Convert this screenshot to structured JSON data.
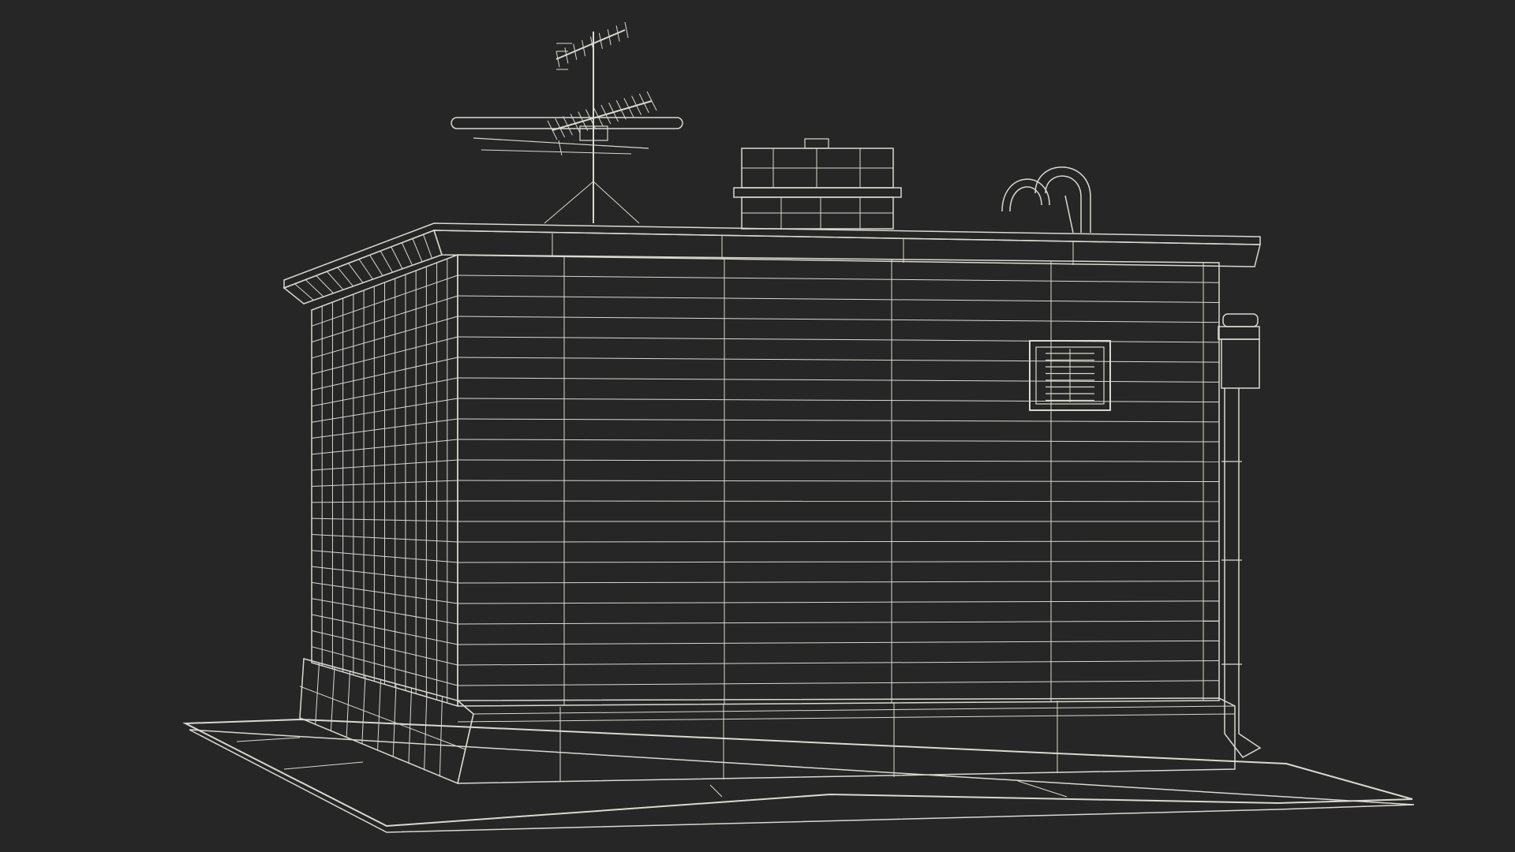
{
  "viewport": {
    "background_color": "#262626"
  },
  "model": {
    "subject": "wireframe-building",
    "surface_color": "#6d6d65",
    "surface_dark_color": "#5f5f58",
    "ground_color": "#6a6a63",
    "wire_color": "#d9d9cf",
    "grid": {
      "right_wall_rows": 22,
      "left_wall_rows": 22,
      "left_wall_columns": 14
    },
    "parts": [
      "ground-slab",
      "left-wall",
      "front-wall",
      "plinth",
      "roof-parapet",
      "chimney",
      "tv-antenna",
      "roof-pipes",
      "wall-vent",
      "drain-pipe",
      "gutter-box"
    ]
  }
}
